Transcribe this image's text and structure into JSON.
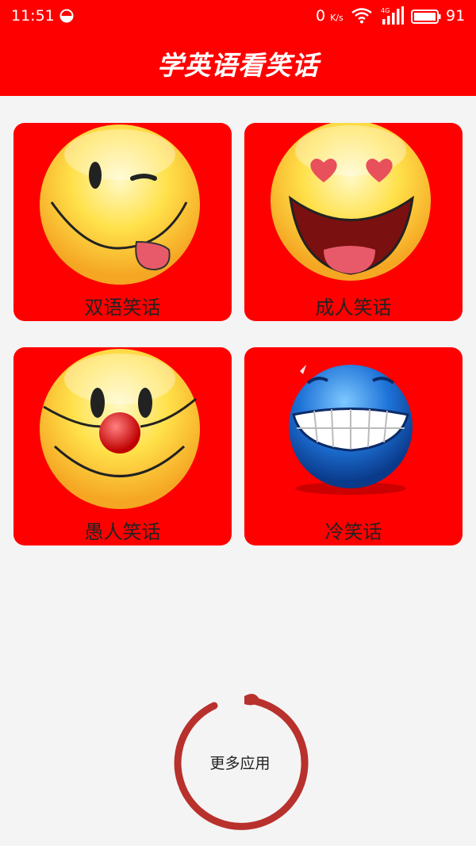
{
  "status_bar": {
    "time": "11:51",
    "speed": "0",
    "speed_unit": "K/s",
    "network": "4G",
    "battery": "91"
  },
  "header": {
    "title": "学英语看笑话"
  },
  "cards": [
    {
      "label": "双语笑话",
      "icon": "wink-tongue-emoji-icon"
    },
    {
      "label": "成人笑话",
      "icon": "heart-eyes-emoji-icon"
    },
    {
      "label": "愚人笑话",
      "icon": "clown-nose-emoji-icon"
    },
    {
      "label": "冷笑话",
      "icon": "blue-grin-emoji-icon"
    }
  ],
  "more_apps": {
    "label": "更多应用"
  },
  "colors": {
    "brand_red": "#ff0000",
    "background": "#f4f4f4",
    "ring": "#b8312c"
  }
}
